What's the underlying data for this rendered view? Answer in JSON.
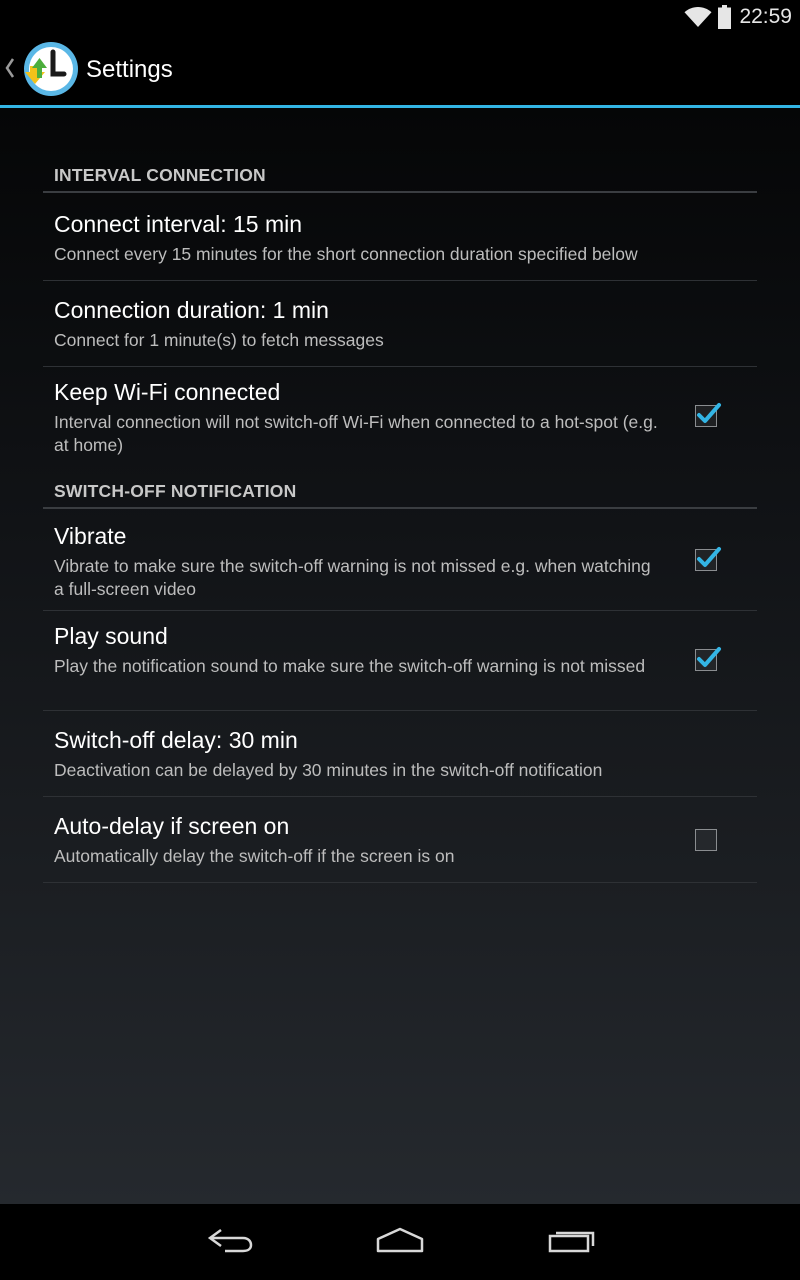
{
  "status_bar": {
    "time": "22:59",
    "wifi_icon": "wifi-icon",
    "battery_icon": "battery-icon"
  },
  "action_bar": {
    "up_icon": "up-caret-icon",
    "app_icon": "app-logo-icon",
    "title": "Settings",
    "accent_color": "#33b5e5"
  },
  "categories": [
    {
      "title": "INTERVAL CONNECTION",
      "prefs": [
        {
          "title": "Connect interval: 15 min",
          "summary": "Connect every 15 minutes for the short connection duration specified below"
        },
        {
          "title": "Connection duration: 1 min",
          "summary": "Connect for 1 minute(s) to fetch messages"
        },
        {
          "title": "Keep Wi-Fi connected",
          "summary": "Interval connection will not switch-off Wi-Fi when connected to a hot-spot (e.g. at home)",
          "checked": true
        }
      ]
    },
    {
      "title": "SWITCH-OFF NOTIFICATION",
      "prefs": [
        {
          "title": "Vibrate",
          "summary": "Vibrate to make sure the switch-off warning is not missed e.g. when watching a full-screen video",
          "checked": true
        },
        {
          "title": "Play sound",
          "summary": "Play the notification sound to make sure the switch-off warning is not missed",
          "checked": true
        },
        {
          "title": "Switch-off delay: 30 min",
          "summary": "Deactivation can be delayed by 30 minutes in the switch-off notification"
        },
        {
          "title": "Auto-delay if screen on",
          "summary": "Automatically delay the switch-off if the screen is on",
          "checked": false
        }
      ]
    }
  ],
  "nav_bar": {
    "back_icon": "back-icon",
    "home_icon": "home-icon",
    "recents_icon": "recents-icon"
  }
}
